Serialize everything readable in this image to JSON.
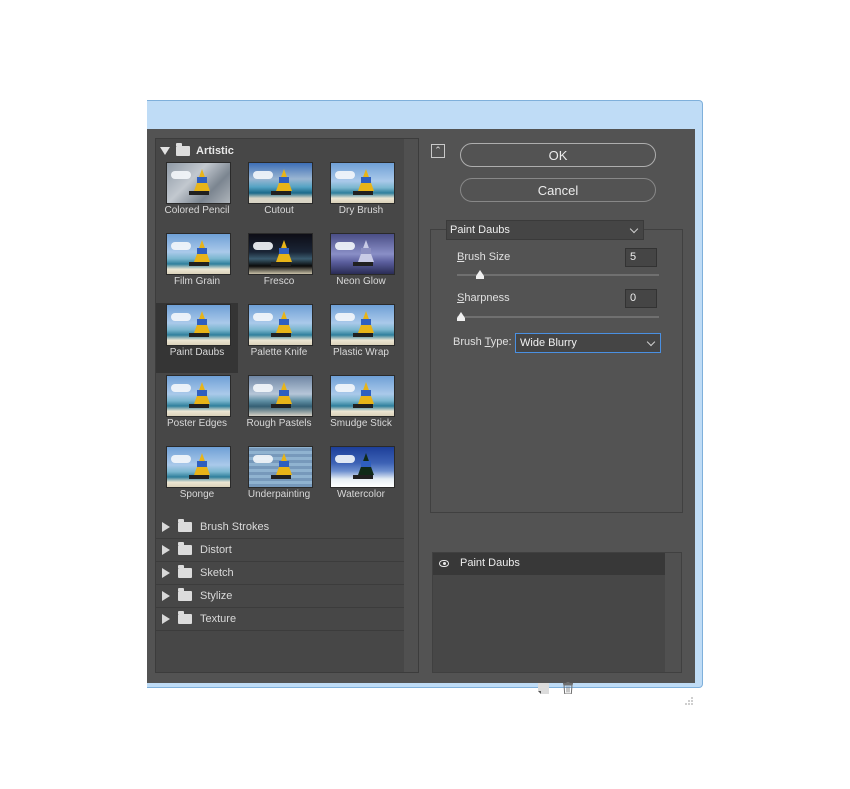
{
  "gallery": {
    "open_category": "Artistic",
    "filters": [
      {
        "label": "Colored Pencil",
        "thumb": "t-pencil"
      },
      {
        "label": "Cutout",
        "thumb": "t-cutout"
      },
      {
        "label": "Dry Brush",
        "thumb": ""
      },
      {
        "label": "Film Grain",
        "thumb": ""
      },
      {
        "label": "Fresco",
        "thumb": "t-fresco"
      },
      {
        "label": "Neon Glow",
        "thumb": "t-neon"
      },
      {
        "label": "Paint Daubs",
        "thumb": "",
        "selected": true
      },
      {
        "label": "Palette Knife",
        "thumb": ""
      },
      {
        "label": "Plastic Wrap",
        "thumb": ""
      },
      {
        "label": "Poster Edges",
        "thumb": ""
      },
      {
        "label": "Rough Pastels",
        "thumb": "t-rough"
      },
      {
        "label": "Smudge Stick",
        "thumb": ""
      },
      {
        "label": "Sponge",
        "thumb": ""
      },
      {
        "label": "Underpainting",
        "thumb": "t-under"
      },
      {
        "label": "Watercolor",
        "thumb": "t-water"
      }
    ],
    "categories": [
      "Brush Strokes",
      "Distort",
      "Sketch",
      "Stylize",
      "Texture"
    ]
  },
  "buttons": {
    "ok": "OK",
    "cancel": "Cancel"
  },
  "settings": {
    "filter": "Paint Daubs",
    "brush_size": {
      "label_first": "B",
      "label_rest": "rush Size",
      "value": "5",
      "level": 0.1
    },
    "sharpness": {
      "label_first": "S",
      "label_rest": "harpness",
      "value": "0",
      "level": 0.0
    },
    "brush_type": {
      "label_pre": "Brush ",
      "label_underlined": "T",
      "label_post": "ype:",
      "value": "Wide Blurry"
    }
  },
  "layers": {
    "items": [
      "Paint Daubs"
    ]
  }
}
